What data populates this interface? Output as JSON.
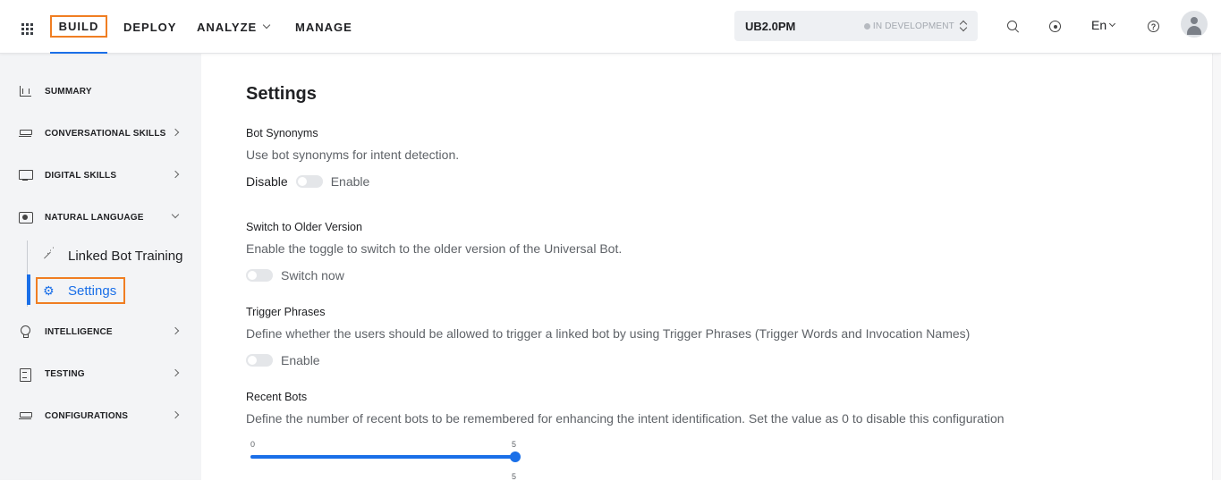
{
  "header": {
    "nav": [
      {
        "label": "BUILD"
      },
      {
        "label": "DEPLOY"
      },
      {
        "label": "ANALYZE"
      },
      {
        "label": "MANAGE"
      }
    ],
    "bot_name": "UB2.0PM",
    "bot_status": "IN DEVELOPMENT",
    "language": "En"
  },
  "sidebar": {
    "items": [
      {
        "label": "SUMMARY",
        "icon": "chart-icon"
      },
      {
        "label": "CONVERSATIONAL SKILLS",
        "icon": "layers-icon"
      },
      {
        "label": "DIGITAL SKILLS",
        "icon": "monitor-icon"
      },
      {
        "label": "NATURAL LANGUAGE",
        "icon": "natural-language-icon"
      },
      {
        "label": "INTELLIGENCE",
        "icon": "bulb-icon"
      },
      {
        "label": "TESTING",
        "icon": "clipboard-icon"
      },
      {
        "label": "CONFIGURATIONS",
        "icon": "config-icon"
      }
    ],
    "sub_items": [
      {
        "label": "Linked Bot Training",
        "icon": "wand-icon"
      },
      {
        "label": "Settings",
        "icon": "gear-icon"
      }
    ]
  },
  "main": {
    "title": "Settings",
    "sections": [
      {
        "title": "Bot Synonyms",
        "description": "Use bot synonyms for intent detection.",
        "toggle_before": "Disable",
        "toggle_after": "Enable",
        "enabled": false
      },
      {
        "title": "Switch to Older Version",
        "description": "Enable the toggle to switch to the older version of the Universal Bot.",
        "toggle_after": "Switch now",
        "enabled": false
      },
      {
        "title": "Trigger Phrases",
        "description": "Define whether the users should be allowed to trigger a linked bot by using Trigger Phrases (Trigger Words and Invocation Names)",
        "toggle_after": "Enable",
        "enabled": false
      },
      {
        "title": "Recent Bots",
        "description": "Define the number of recent bots to be remembered for enhancing the intent identification. Set the value as 0 to disable this configuration",
        "slider": {
          "min": "0",
          "max": "5",
          "value": "5"
        }
      }
    ]
  },
  "colors": {
    "accent": "#1a6fe8",
    "highlight": "#f07e22",
    "sidebar_bg": "#f3f4f6"
  }
}
